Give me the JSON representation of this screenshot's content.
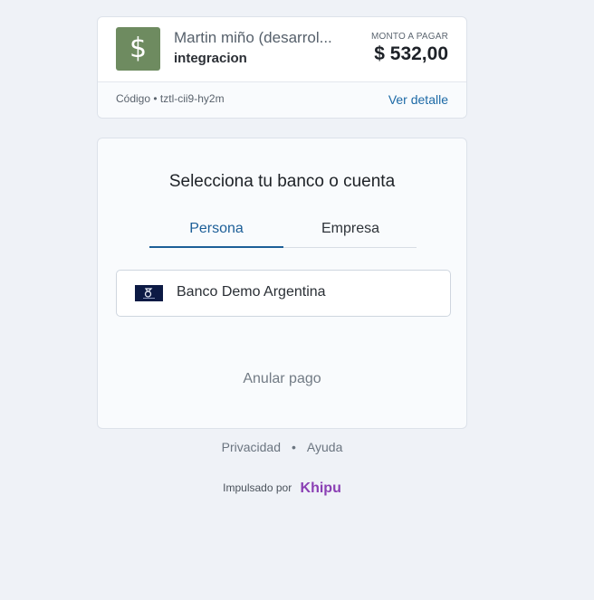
{
  "payment": {
    "merchant_icon": "$",
    "merchant_name": "Martin miño (desarrol...",
    "subject": "integracion",
    "amount_label": "MONTO A PAGAR",
    "amount": "$ 532,00",
    "code": "Código • tztl-cii9-hy2m",
    "detail_link": "Ver detalle",
    "merchant_color": "#6e8b60"
  },
  "bank_selection": {
    "title": "Selecciona tu banco o cuenta",
    "tabs": [
      {
        "label": "Persona",
        "active": true
      },
      {
        "label": "Empresa",
        "active": false
      }
    ],
    "banks": [
      {
        "name": "Banco Demo Argentina",
        "logo": "bank-logo-icon"
      }
    ],
    "cancel": "Anular pago"
  },
  "footer": {
    "privacy": "Privacidad",
    "separator": "•",
    "help": "Ayuda",
    "powered_by": "Impulsado por",
    "brand": "Khipu",
    "brand_color": "#8a3fb4"
  }
}
